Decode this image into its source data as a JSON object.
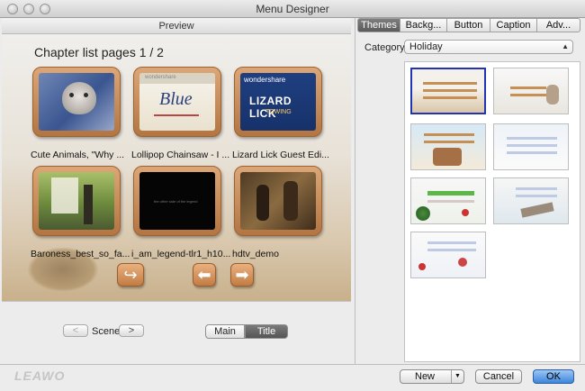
{
  "window": {
    "title": "Menu Designer"
  },
  "preview": {
    "header": "Preview",
    "chapter_title": "Chapter list pages 1 / 2",
    "chapters": [
      {
        "caption": "Cute Animals, \"Why ..."
      },
      {
        "caption": "Lollipop Chainsaw - I ..."
      },
      {
        "caption": "Lizard Lick Guest Edi..."
      },
      {
        "caption": "Baroness_best_so_fa..."
      },
      {
        "caption": "i_am_legend-tlr1_h10..."
      },
      {
        "caption": "hdtv_demo"
      }
    ],
    "thumb_text": {
      "wondershare": "wondershare",
      "blue": "Blue",
      "lizard": "LIZARD LICK",
      "towing": "TOWING",
      "legend_line": "the other side of the legend"
    }
  },
  "scene": {
    "label": "Scene",
    "prev": "<",
    "next": ">"
  },
  "view_toggle": {
    "main": "Main",
    "title": "Title",
    "selected": "Title"
  },
  "tabs": [
    "Themes",
    "Backg...",
    "Button",
    "Caption",
    "Adv..."
  ],
  "active_tab": "Themes",
  "category": {
    "label": "Category",
    "value": "Holiday"
  },
  "bottom": {
    "logo": "LEAWO",
    "new": "New",
    "cancel": "Cancel",
    "ok": "OK"
  }
}
